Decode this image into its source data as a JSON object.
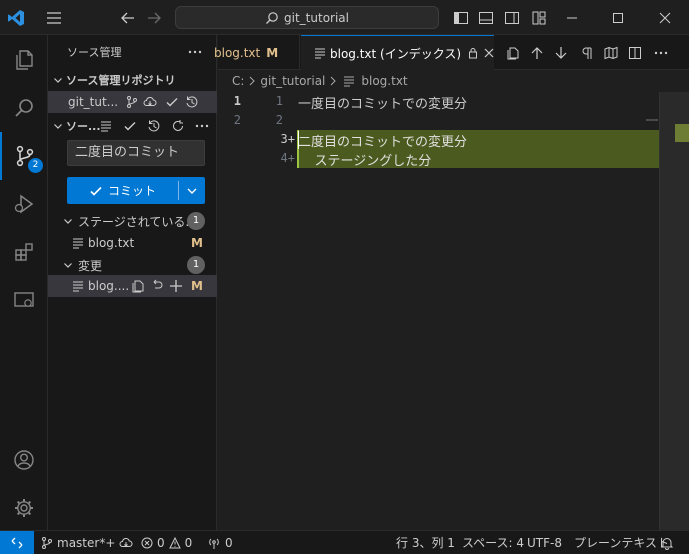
{
  "titlebar": {
    "search_text": "git_tutorial"
  },
  "activity": {
    "scm_badge": "2"
  },
  "sidebar": {
    "title": "ソース管理",
    "repos_header": "ソース管理リポジトリ",
    "repo_name": "git_tut...",
    "changes_header": "ソー...",
    "commit_message": "二度目のコミット",
    "commit_button": "コミット",
    "staged_group": {
      "label": "ステージされている...",
      "count": "1",
      "files": [
        {
          "name": "blog.txt",
          "status": "M"
        }
      ]
    },
    "changes_group": {
      "label": "変更",
      "count": "1",
      "files": [
        {
          "name": "blog....",
          "status": "M"
        }
      ]
    }
  },
  "tabs": [
    {
      "label": "blog.txt",
      "status": "M",
      "active": false
    },
    {
      "label": "blog.txt (インデックス)",
      "active": true
    }
  ],
  "breadcrumb": [
    "C:",
    "git_tutorial",
    "blog.txt"
  ],
  "editor": {
    "original": [
      {
        "num": "1",
        "text": "一度目のコミットでの変更分"
      },
      {
        "num": "2",
        "text": ""
      }
    ],
    "modified": [
      {
        "num": "1",
        "text": "一度目のコミットでの変更分"
      },
      {
        "num": "2",
        "text": ""
      },
      {
        "num": "3+",
        "text": "二度目のコミットでの変更分"
      },
      {
        "num": "4+",
        "text": "    ステージングした分"
      }
    ]
  },
  "statusbar": {
    "branch": "master*+",
    "errors": "0",
    "warnings": "0",
    "ports": "0",
    "position": "行 3、列 1",
    "spaces": "スペース: 4",
    "encoding": "UTF-8",
    "language": "プレーンテキスト"
  },
  "colors": {
    "accent": "#0078d4",
    "added_line": "#4b5a1e",
    "modified_letter": "#e2c08d"
  }
}
